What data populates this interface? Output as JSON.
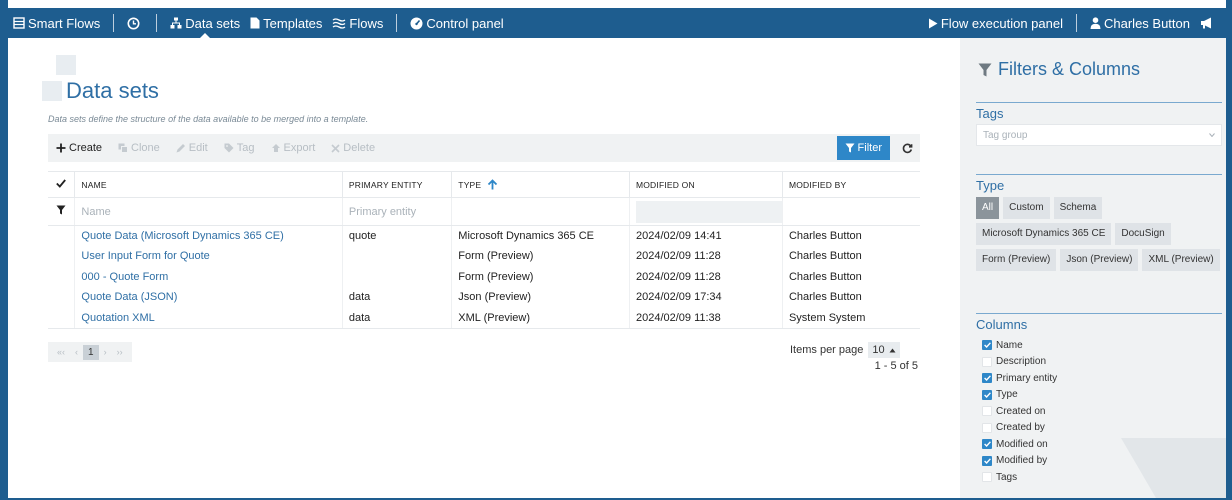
{
  "topbar": {
    "brand": "Smart Flows",
    "nav": [
      {
        "label": "Data sets",
        "icon": "sitemap-icon",
        "active": true
      },
      {
        "label": "Templates",
        "icon": "file-icon",
        "active": false
      },
      {
        "label": "Flows",
        "icon": "waves-icon",
        "active": false
      }
    ],
    "control_panel": "Control panel",
    "flow_execution": "Flow execution panel",
    "user": "Charles Button"
  },
  "page": {
    "title": "Data sets",
    "description": "Data sets define the structure of the data available to be merged into a template."
  },
  "toolbar": {
    "create": "Create",
    "clone": "Clone",
    "edit": "Edit",
    "tag": "Tag",
    "export": "Export",
    "delete": "Delete",
    "filter": "Filter"
  },
  "table": {
    "headers": {
      "name": "NAME",
      "primary_entity": "PRIMARY ENTITY",
      "type": "TYPE",
      "modified_on": "MODIFIED ON",
      "modified_by": "MODIFIED BY"
    },
    "filters": {
      "name_placeholder": "Name",
      "primary_entity_placeholder": "Primary entity"
    },
    "rows": [
      {
        "name": "Quote Data (Microsoft Dynamics 365 CE)",
        "primary_entity": "quote",
        "type": "Microsoft Dynamics 365 CE",
        "modified_on": "2024/02/09 14:41",
        "modified_by": "Charles Button"
      },
      {
        "name": "User Input Form for Quote",
        "primary_entity": "",
        "type": "Form (Preview)",
        "modified_on": "2024/02/09 11:28",
        "modified_by": "Charles Button"
      },
      {
        "name": "000 - Quote Form",
        "primary_entity": "",
        "type": "Form (Preview)",
        "modified_on": "2024/02/09 11:28",
        "modified_by": "Charles Button"
      },
      {
        "name": "Quote Data (JSON)",
        "primary_entity": "data",
        "type": "Json (Preview)",
        "modified_on": "2024/02/09 17:34",
        "modified_by": "Charles Button"
      },
      {
        "name": "Quotation XML",
        "primary_entity": "data",
        "type": "XML (Preview)",
        "modified_on": "2024/02/09 11:38",
        "modified_by": "System System"
      }
    ]
  },
  "pager": {
    "first": "«‹",
    "prev": "‹",
    "current_page": "1",
    "next": "›",
    "last": "››",
    "items_per_page_label": "Items per page",
    "items_per_page": "10",
    "range": "1 - 5 of 5"
  },
  "side": {
    "title": "Filters & Columns",
    "tags_title": "Tags",
    "tag_placeholder": "Tag group",
    "type_title": "Type",
    "types": [
      {
        "label": "All",
        "on": true
      },
      {
        "label": "Custom",
        "on": false
      },
      {
        "label": "Schema",
        "on": false
      },
      {
        "label": "Microsoft Dynamics 365 CE",
        "on": false
      },
      {
        "label": "DocuSign",
        "on": false
      },
      {
        "label": "Form (Preview)",
        "on": false
      },
      {
        "label": "Json (Preview)",
        "on": false
      },
      {
        "label": "XML (Preview)",
        "on": false
      }
    ],
    "columns_title": "Columns",
    "columns": [
      {
        "label": "Name",
        "checked": true
      },
      {
        "label": "Description",
        "checked": false
      },
      {
        "label": "Primary entity",
        "checked": true
      },
      {
        "label": "Type",
        "checked": true
      },
      {
        "label": "Created on",
        "checked": false
      },
      {
        "label": "Created by",
        "checked": false
      },
      {
        "label": "Modified on",
        "checked": true
      },
      {
        "label": "Modified by",
        "checked": true
      },
      {
        "label": "Tags",
        "checked": false
      }
    ]
  },
  "colors": {
    "primary": "#1e5d8f",
    "accent": "#2e87c8",
    "link": "#2f6fa5"
  }
}
